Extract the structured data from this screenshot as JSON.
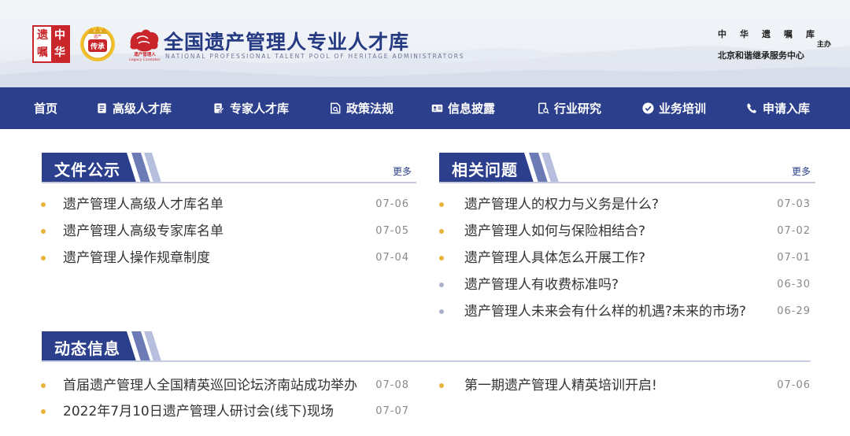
{
  "header": {
    "logo_badge_chars": [
      "遗",
      "中",
      "嘱",
      "华"
    ],
    "logo_badge_center": "传承",
    "logo_badge_top": "遗产",
    "logo_caption_cn": "遗产管理人",
    "logo_caption_en": "Legacy Caretaker",
    "title": "全国遗产管理人专业人才库",
    "subtitle": "NATIONAL PROFESSIONAL TALENT POOL OF HERITAGE ADMINISTRATORS",
    "sponsor_chars": [
      "中",
      "华",
      "遗",
      "嘱",
      "库"
    ],
    "sponsor_role": "主办",
    "sponsor_org": "北京和谐继承服务中心"
  },
  "nav": {
    "items": [
      {
        "label": "首页",
        "icon": "none"
      },
      {
        "label": "高级人才库",
        "icon": "document-icon"
      },
      {
        "label": "专家人才库",
        "icon": "edit-document-icon"
      },
      {
        "label": "政策法规",
        "icon": "search-document-icon"
      },
      {
        "label": "信息披露",
        "icon": "id-card-icon"
      },
      {
        "label": "行业研究",
        "icon": "research-icon"
      },
      {
        "label": "业务培训",
        "icon": "check-circle-icon"
      },
      {
        "label": "申请入库",
        "icon": "phone-icon"
      }
    ]
  },
  "sections": {
    "files": {
      "title": "文件公示",
      "more": "更多",
      "items": [
        {
          "title": "遗产管理人高级人才库名单",
          "date": "07-06"
        },
        {
          "title": "遗产管理人高级专家库名单",
          "date": "07-05"
        },
        {
          "title": "遗产管理人操作规章制度",
          "date": "07-04"
        }
      ]
    },
    "faq": {
      "title": "相关问题",
      "more": "更多",
      "items": [
        {
          "title": "遗产管理人的权力与义务是什么?",
          "date": "07-03"
        },
        {
          "title": "遗产管理人如何与保险相结合?",
          "date": "07-02"
        },
        {
          "title": "遗产管理人具体怎么开展工作?",
          "date": "07-01"
        },
        {
          "title": "遗产管理人有收费标准吗?",
          "date": "06-30"
        },
        {
          "title": "遗产管理人未来会有什么样的机遇?未来的市场?",
          "date": "06-29"
        }
      ]
    },
    "news": {
      "title": "动态信息",
      "items_left": [
        {
          "title": "首届遗产管理人全国精英巡回论坛济南站成功举办",
          "date": "07-08"
        },
        {
          "title": "2022年7月10日遗产管理人研讨会(线下)现场",
          "date": "07-07"
        }
      ],
      "items_right": [
        {
          "title": "第一期遗产管理人精英培训开启!",
          "date": "07-06"
        }
      ]
    }
  },
  "colors": {
    "brand_blue": "#2b3f8c",
    "title_blue": "#253a82",
    "dot_gold": "#e8b43a",
    "dot_grey": "#aab0c8",
    "logo_red": "#c8262b"
  }
}
